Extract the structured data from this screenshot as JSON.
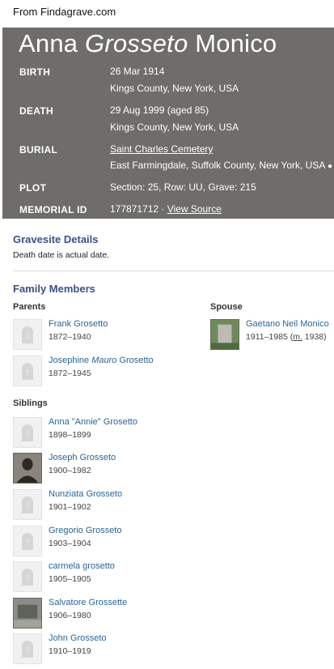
{
  "source_line": "From Findagrave.com",
  "memorial": {
    "name_first": "Anna",
    "name_maiden": "Grosseto",
    "name_last": "Monico",
    "facts": {
      "birth_label": "BIRTH",
      "birth_date": "26 Mar 1914",
      "birth_place": "Kings County, New York, USA",
      "death_label": "DEATH",
      "death_date": "29 Aug 1999 (aged 85)",
      "death_place": "Kings County, New York, USA",
      "burial_label": "BURIAL",
      "burial_cemetery": "Saint Charles Cemetery",
      "burial_place": "East Farmingdale, Suffolk County, New York, USA",
      "plot_label": "PLOT",
      "plot_value": "Section: 25, Row: UU, Grave: 215",
      "memorial_id_label": "MEMORIAL ID",
      "memorial_id_value": "177871712 ·",
      "view_source": "View Source"
    }
  },
  "gravesite": {
    "title": "Gravesite Details",
    "note": "Death date is actual date."
  },
  "family": {
    "title": "Family Members",
    "parents_label": "Parents",
    "spouse_label": "Spouse",
    "siblings_label": "Siblings",
    "parents": [
      {
        "name": "Frank Grosetto",
        "dates": "1872–1940"
      },
      {
        "name_before": "Josephine ",
        "name_italic": "Mauro",
        "name_after": " Grosetto",
        "dates": "1872–1945"
      }
    ],
    "spouse": {
      "name": "Gaetano Neil Monico",
      "dates": "1911–1985 (",
      "marriage_abbr": "m.",
      "marriage_year": " 1938)"
    },
    "siblings": [
      {
        "name": "Anna \"Annie\" Grosetto",
        "dates": "1898–1899"
      },
      {
        "name": "Joseph Grosseto",
        "dates": "1900–1982"
      },
      {
        "name": "Nunziata Grosseto",
        "dates": "1901–1902"
      },
      {
        "name": "Gregorio Grosseto",
        "dates": "1903–1904"
      },
      {
        "name": "carmela grosetto",
        "dates": "1905–1905"
      },
      {
        "name": "Salvatore Grossette",
        "dates": "1906–1980"
      },
      {
        "name": "John Grosseto",
        "dates": "1910–1919"
      }
    ]
  }
}
